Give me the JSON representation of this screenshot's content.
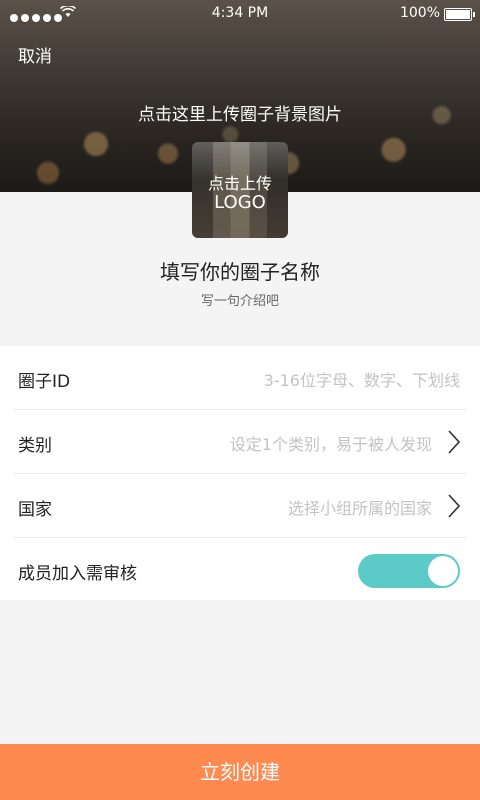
{
  "status_bar": {
    "time": "4:34 PM",
    "battery": "100%"
  },
  "header": {
    "cancel_label": "取消",
    "upload_background_label": "点击这里上传圈子背景图片",
    "upload_logo_line1": "点击上传",
    "upload_logo_line2": "LOGO"
  },
  "profile": {
    "name_placeholder": "填写你的圈子名称",
    "intro_placeholder": "写一句介绍吧"
  },
  "form": {
    "rows": [
      {
        "label": "圈子ID",
        "hint": "3-16位字母、数字、下划线"
      },
      {
        "label": "类别",
        "hint": "设定1个类别，易于被人发现"
      },
      {
        "label": "国家",
        "hint": "选择小组所属的国家"
      },
      {
        "label": "成员加入需审核",
        "toggle_on": true
      }
    ]
  },
  "footer": {
    "create_label": "立刻创建"
  },
  "colors": {
    "accent": "#ff8a50",
    "toggle": "#5ccbc7"
  }
}
